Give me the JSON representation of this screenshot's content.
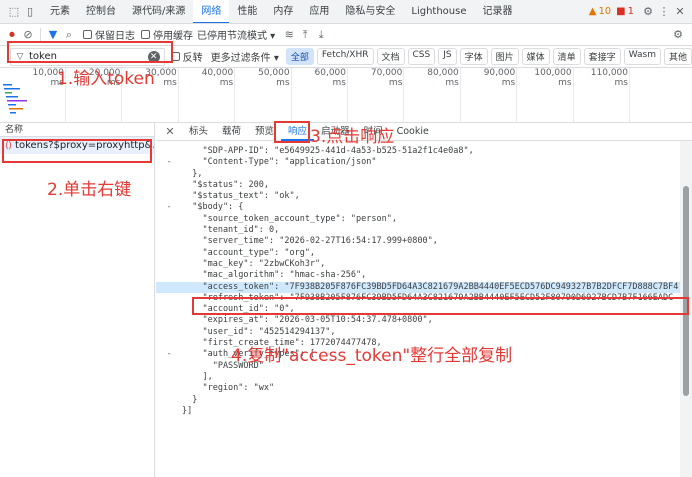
{
  "tabs": {
    "items": [
      "元素",
      "控制台",
      "源代码/来源",
      "网络",
      "性能",
      "内存",
      "应用",
      "隐私与安全",
      "Lighthouse",
      "记录器"
    ],
    "active": 3,
    "warnings": "10",
    "errors": "1"
  },
  "toolbar": {
    "preserve_log": "保留日志",
    "disable_cache": "停用缓存",
    "throttle": "已停用节流模式"
  },
  "filter": {
    "value": "token",
    "invert": "反转",
    "more": "更多过滤条件",
    "types": [
      "全部",
      "Fetch/XHR",
      "文档",
      "CSS",
      "JS",
      "字体",
      "图片",
      "媒体",
      "清单",
      "套接字",
      "Wasm",
      "其他"
    ]
  },
  "timeline": {
    "ticks": [
      "10,000 ms",
      "20,000 ms",
      "30,000 ms",
      "40,000 ms",
      "50,000 ms",
      "60,000 ms",
      "70,000 ms",
      "80,000 ms",
      "90,000 ms",
      "100,000 ms",
      "110,000 ms"
    ]
  },
  "requests": {
    "header": "名称",
    "row": "tokens?$proxy=proxyhttp&..."
  },
  "detail": {
    "tabs": [
      "标头",
      "载荷",
      "预览",
      "响应",
      "启动器",
      "时间",
      "Cookie"
    ],
    "active": 3
  },
  "code": [
    [
      "",
      "    \"SDP-APP-ID\": \"e5649925-441d-4a53-b525-51a2f1c4e0a8\","
    ],
    [
      "-",
      "    \"Content-Type\": \"application/json\""
    ],
    [
      "",
      "  },"
    ],
    [
      "",
      "  \"$status\": 200,"
    ],
    [
      "",
      "  \"$status_text\": \"ok\","
    ],
    [
      "-",
      "  \"$body\": {"
    ],
    [
      "",
      "    \"source_token_account_type\": \"person\","
    ],
    [
      "",
      "    \"tenant_id\": 0,"
    ],
    [
      "",
      "    \"server_time\": \"2026-02-27T16:54:17.999+0800\","
    ],
    [
      "",
      "    \"account_type\": \"org\","
    ],
    [
      "",
      "    \"mac_key\": \"2zbwCKoh3r\","
    ],
    [
      "",
      "    \"mac_algorithm\": \"hmac-sha-256\","
    ],
    [
      "",
      "    \"access_token\": \"7F938B205F876FC39BD5FD64A3C821679A2BB4440EF5ECD576DC949327B7B2DFCF7D888C7BF4"
    ],
    [
      "",
      "    \"refresh_token\": \"7F938B205F876FC39BD5FD64A3C821679A2BB4440EF5ECD52F80790D6927BCD7B7F166EADC"
    ],
    [
      "",
      "    \"account_id\": \"0\","
    ],
    [
      "",
      "    \"expires_at\": \"2026-03-05T10:54:37.478+0800\","
    ],
    [
      "",
      "    \"user_id\": \"452514294137\","
    ],
    [
      "",
      "    \"first_create_time\": 1772074477478,"
    ],
    [
      "-",
      "    \"auth_verify_types\": ["
    ],
    [
      "",
      "      \"PASSWORD\""
    ],
    [
      "",
      "    ],"
    ],
    [
      "",
      "    \"region\": \"wx\""
    ],
    [
      "",
      "  }"
    ],
    [
      "",
      "}]"
    ]
  ],
  "annotations": {
    "a1": "1.输入token",
    "a2": "2.单击右键",
    "a3": "3.点击响应",
    "a4": "4.复制\"access_token\"整行全部复制"
  },
  "colors": {
    "accent": "#1a73e8",
    "annotation": "#e53935"
  }
}
